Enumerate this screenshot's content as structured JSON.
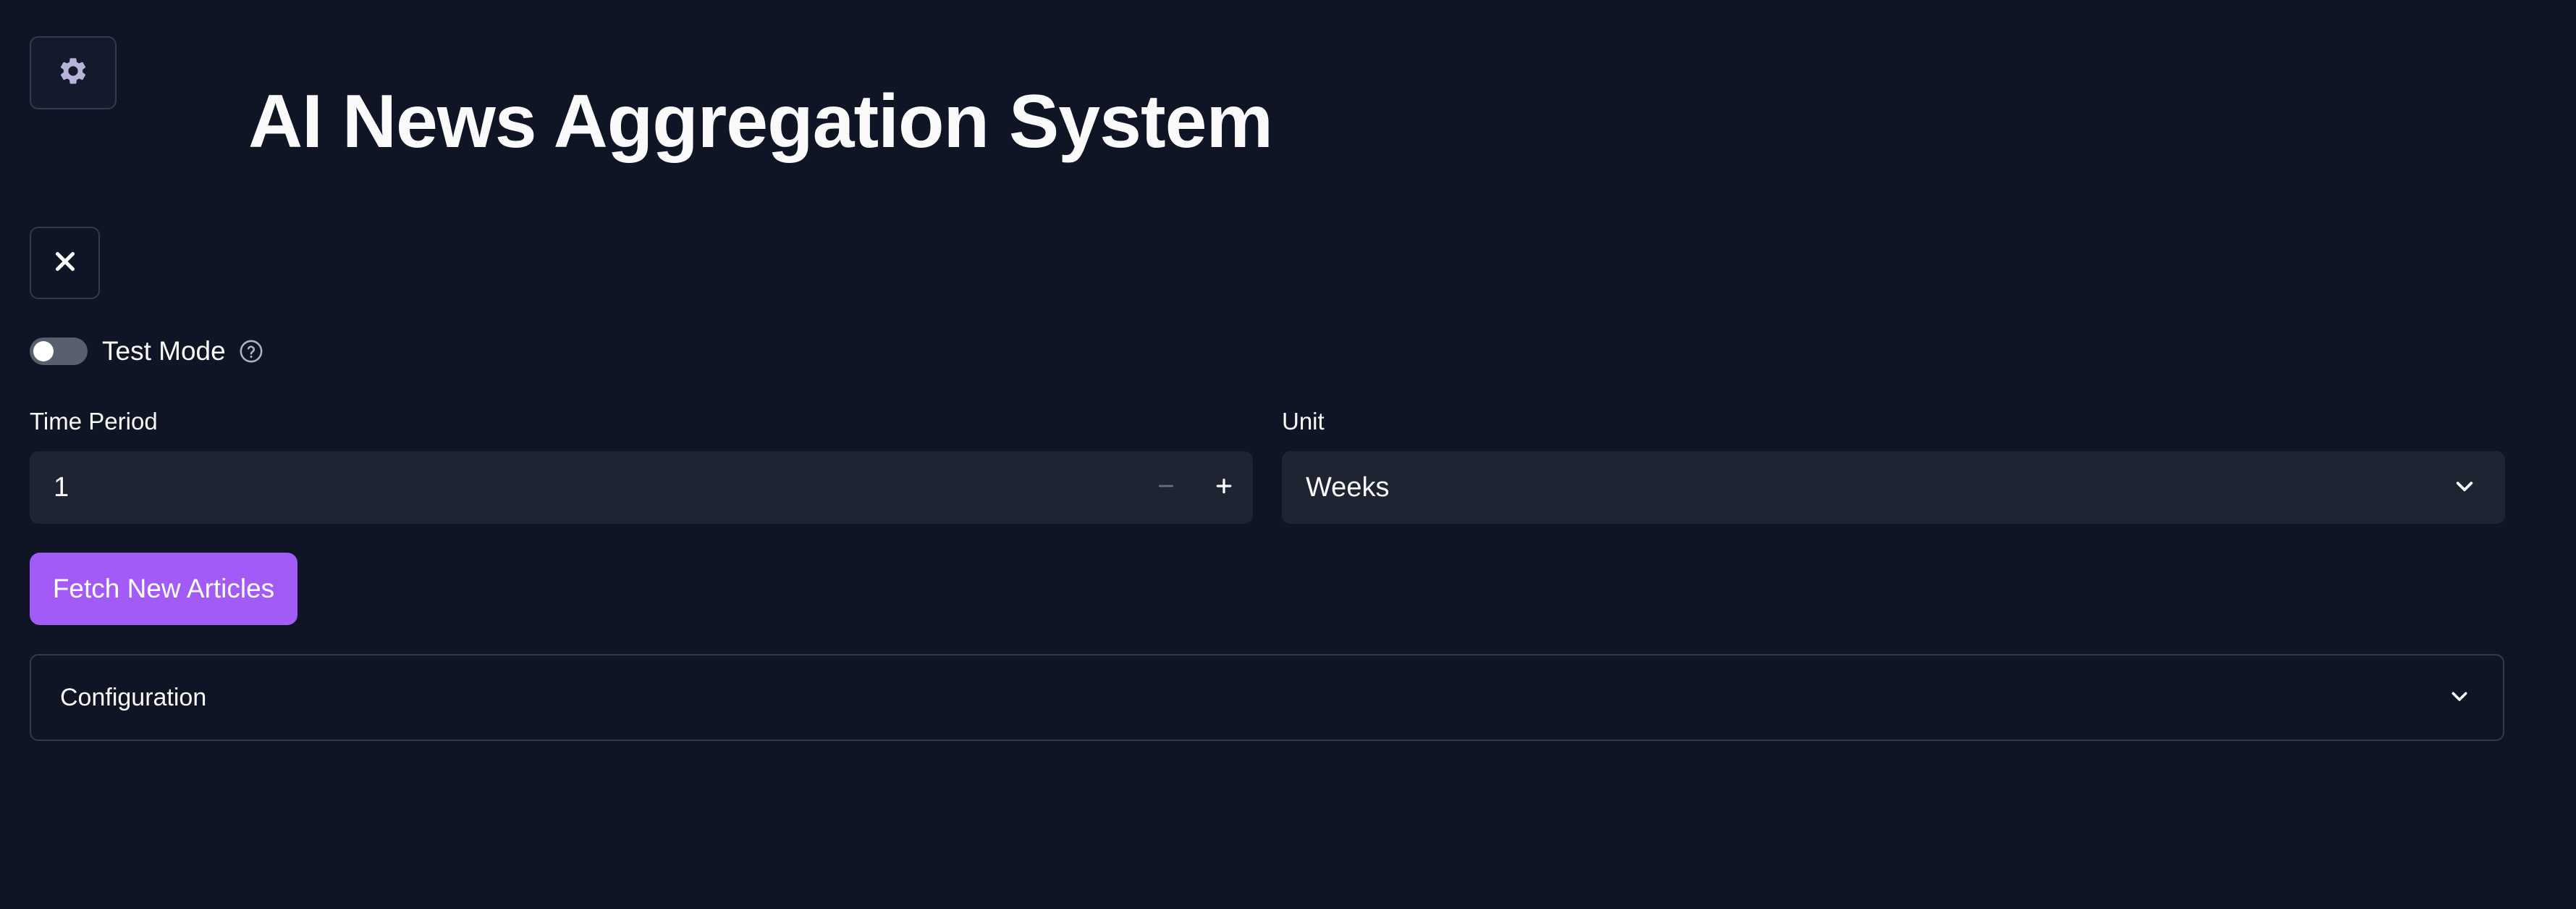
{
  "app": {
    "title": "AI News Aggregation System"
  },
  "toolbar": {
    "settings_icon": "gear-icon",
    "close_icon": "close-icon"
  },
  "test_mode": {
    "label": "Test Mode",
    "enabled": false,
    "help_icon": "question-circle-icon"
  },
  "time_period": {
    "label": "Time Period",
    "value": "1",
    "decrement_icon": "minus-icon",
    "increment_icon": "plus-icon"
  },
  "unit": {
    "label": "Unit",
    "selected": "Weeks",
    "chevron_icon": "chevron-down-icon"
  },
  "fetch_button": {
    "label": "Fetch New Articles",
    "color": "#a35bf7"
  },
  "configuration": {
    "label": "Configuration",
    "expanded": false,
    "chevron_icon": "chevron-down-icon"
  },
  "colors": {
    "background": "#0f1524",
    "input_background": "#1f2433",
    "border": "#333a4d",
    "text": "#fafafa"
  }
}
